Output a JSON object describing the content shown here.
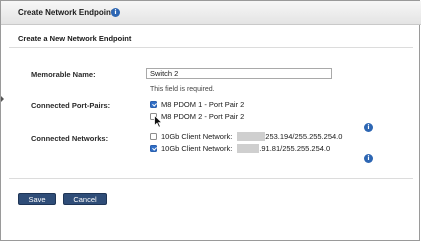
{
  "dialog": {
    "title": "Create Network Endpoint",
    "subtitle": "Create a New Network Endpoint"
  },
  "form": {
    "memorable_name": {
      "label": "Memorable Name:",
      "value": "Switch 2",
      "help": "This field is required."
    },
    "port_pairs": {
      "label": "Connected Port-Pairs:",
      "items": [
        {
          "label": "M8 PDOM 1 - Port Pair 2",
          "checked": true
        },
        {
          "label": "M8 PDOM 2 - Port Pair 2",
          "checked": false
        }
      ]
    },
    "networks": {
      "label": "Connected Networks:",
      "items": [
        {
          "prefix": "10Gb Client Network:",
          "suffix": "253.194/255.255.254.0",
          "checked": false
        },
        {
          "prefix": "10Gb Client Network:",
          "suffix": ".91.81/255.255.254.0",
          "checked": true
        }
      ]
    }
  },
  "buttons": {
    "save": "Save",
    "cancel": "Cancel"
  },
  "icons": {
    "info_glyph": "i"
  },
  "colors": {
    "accent": "#2f6ec6",
    "button": "#2f4d78"
  }
}
